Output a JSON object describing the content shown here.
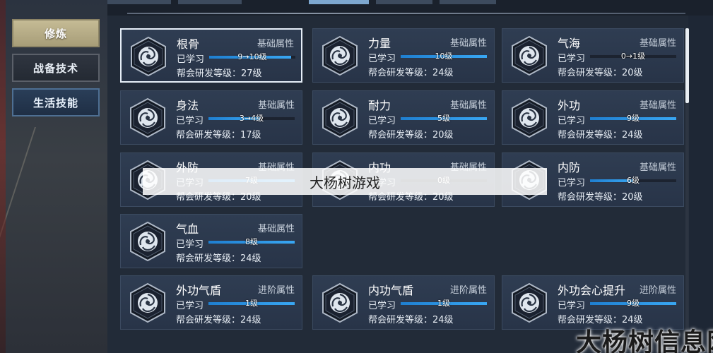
{
  "sidebar": {
    "tabs": [
      {
        "label": "修炼",
        "state": "active"
      },
      {
        "label": "战备技术",
        "state": "normal"
      },
      {
        "label": "生活技能",
        "state": "highlight"
      }
    ]
  },
  "cards": [
    {
      "name": "根骨",
      "type": "基础属性",
      "learned": "已学习",
      "level": "9→10级",
      "progress": 0.95,
      "guild": "帮会研发等级：27级",
      "selected": true,
      "icon": "swirl-emblem-icon"
    },
    {
      "name": "力量",
      "type": "基础属性",
      "learned": "已学习",
      "level": "10级",
      "progress": 1.0,
      "guild": "帮会研发等级：24级",
      "selected": false,
      "icon": "swirl-emblem-icon"
    },
    {
      "name": "气海",
      "type": "基础属性",
      "learned": "已学习",
      "level": "0→1级",
      "progress": 0.0,
      "guild": "帮会研发等级：20级",
      "selected": false,
      "icon": "swirl-emblem-icon"
    },
    {
      "name": "身法",
      "type": "基础属性",
      "learned": "已学习",
      "level": "3→4级",
      "progress": 0.6,
      "guild": "帮会研发等级：17级",
      "selected": false,
      "icon": "swirl-emblem-icon"
    },
    {
      "name": "耐力",
      "type": "基础属性",
      "learned": "已学习",
      "level": "5级",
      "progress": 1.0,
      "guild": "帮会研发等级：20级",
      "selected": false,
      "icon": "swirl-emblem-icon"
    },
    {
      "name": "外功",
      "type": "基础属性",
      "learned": "已学习",
      "level": "9级",
      "progress": 1.0,
      "guild": "帮会研发等级：24级",
      "selected": false,
      "icon": "swirl-emblem-icon"
    },
    {
      "name": "外防",
      "type": "基础属性",
      "learned": "已学习",
      "level": "7级",
      "progress": 1.0,
      "guild": "帮会研发等级：20级",
      "selected": false,
      "icon": "swirl-emblem-icon"
    },
    {
      "name": "内功",
      "type": "基础属性",
      "learned": "已学习",
      "level": "0级",
      "progress": 0.0,
      "guild": "帮会研发等级：20级",
      "selected": false,
      "icon": "swirl-emblem-icon"
    },
    {
      "name": "内防",
      "type": "基础属性",
      "learned": "已学习",
      "level": "6级",
      "progress": 0.5,
      "guild": "帮会研发等级：20级",
      "selected": false,
      "icon": "swirl-emblem-icon"
    },
    {
      "name": "气血",
      "type": "基础属性",
      "learned": "已学习",
      "level": "8级",
      "progress": 1.0,
      "guild": "帮会研发等级：24级",
      "selected": false,
      "icon": "swirl-emblem-icon"
    },
    {
      "name": "外功气盾",
      "type": "进阶属性",
      "learned": "已学习",
      "level": "1级",
      "progress": 1.0,
      "guild": "帮会研发等级：24级",
      "selected": false,
      "icon": "swirl-emblem-icon"
    },
    {
      "name": "内功气盾",
      "type": "进阶属性",
      "learned": "已学习",
      "level": "1级",
      "progress": 1.0,
      "guild": "帮会研发等级：24级",
      "selected": false,
      "icon": "swirl-emblem-icon"
    },
    {
      "name": "外功会心提升",
      "type": "进阶属性",
      "learned": "已学习",
      "level": "9级",
      "progress": 1.0,
      "guild": "帮会研发等级：24级",
      "selected": false,
      "icon": "swirl-emblem-icon"
    }
  ],
  "watermark": {
    "center_text": "大杨树游戏",
    "corner_text": "大杨树信息网"
  },
  "colors": {
    "panel_bg": "#222b38",
    "card_bg": "#2f3d52",
    "progress_fill": "#39a7f3",
    "tab_active": "#c5bb95"
  }
}
